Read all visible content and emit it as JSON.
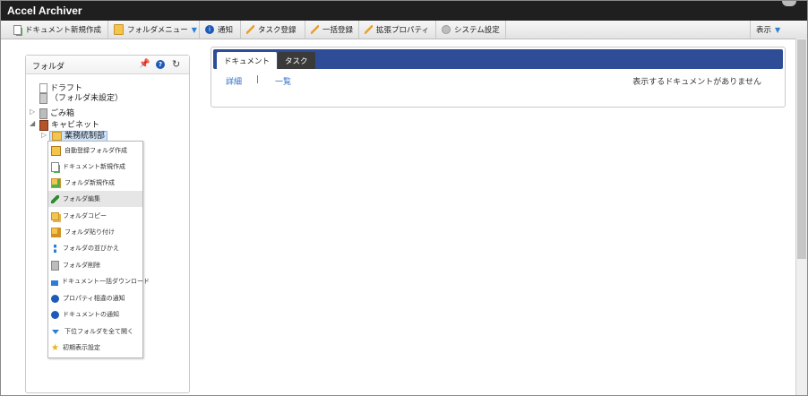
{
  "app": {
    "title": "Accel Archiver"
  },
  "toolbar": {
    "new_document": "ドキュメント新規作成",
    "folder_menu": "フォルダメニュー",
    "notify": "通知",
    "task_register": "タスク登録",
    "bulk_register": "一括登録",
    "extended_property": "拡張プロパティ",
    "system_settings": "システム設定",
    "display": "表示"
  },
  "folder_panel": {
    "title": "フォルダ",
    "tree": {
      "draft_line1": "ドラフト",
      "draft_line2": "（フォルダ未設定）",
      "trash": "ごみ箱",
      "cabinet": "キャビネット",
      "selected_folder": "業務統制部"
    }
  },
  "context_menu": {
    "items": [
      {
        "label": "自動登録フォルダ作成",
        "icon": "auto-register-folder-icon"
      },
      {
        "label": "ドキュメント新規作成",
        "icon": "new-document-icon"
      },
      {
        "label": "フォルダ新規作成",
        "icon": "new-folder-icon"
      },
      {
        "label": "フォルダ編集",
        "icon": "pencil-icon"
      },
      {
        "label": "フォルダコピー",
        "icon": "copy-folder-icon"
      },
      {
        "label": "フォルダ貼り付け",
        "icon": "paste-folder-icon"
      },
      {
        "label": "フォルダの並びかえ",
        "icon": "sort-icon"
      },
      {
        "label": "フォルダ削除",
        "icon": "trash-icon"
      },
      {
        "label": "ドキュメント一括ダウンロード",
        "icon": "download-icon"
      },
      {
        "label": "プロパティ相違の通知",
        "icon": "info-icon"
      },
      {
        "label": "ドキュメントの通知",
        "icon": "info-icon"
      },
      {
        "label": "下位フォルダを全て開く",
        "icon": "chevron-down-icon"
      },
      {
        "label": "初期表示設定",
        "icon": "star-icon"
      }
    ]
  },
  "main": {
    "tabs": [
      "ドキュメント",
      "タスク"
    ],
    "links": {
      "detail": "詳細",
      "separator": "|",
      "list": "一覧"
    },
    "empty_message": "表示するドキュメントがありません"
  }
}
